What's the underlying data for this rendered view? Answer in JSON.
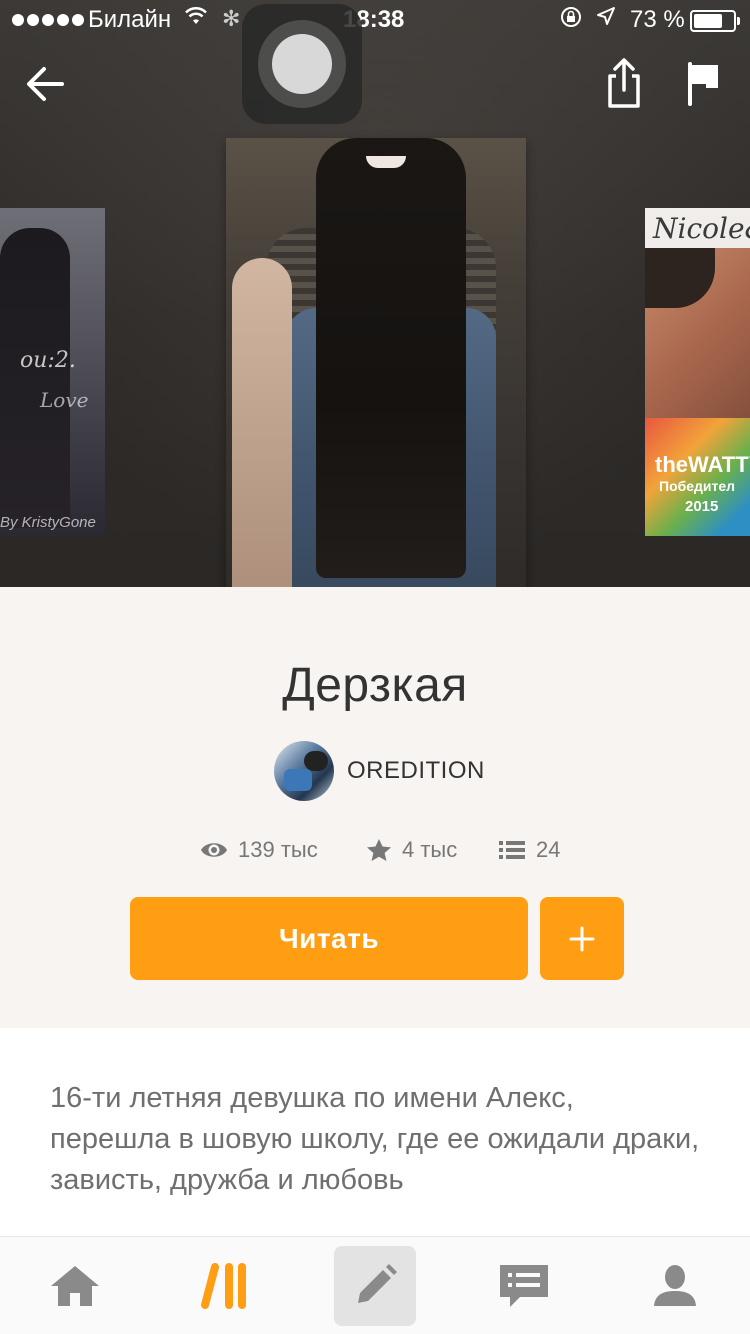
{
  "status_bar": {
    "carrier": "Билайн",
    "time": "18:38",
    "battery_percent": "73 %",
    "battery_level": 0.73
  },
  "toolbar": {
    "back_icon": "arrow-left-icon",
    "share_icon": "share-icon",
    "report_icon": "flag-icon"
  },
  "covers": {
    "left": {
      "title_fragment_1": "ou:2.",
      "title_fragment_2": "Love",
      "author_text": "By KristyGone"
    },
    "right": {
      "title_fragment": "Nicole&",
      "badge_1": "theWATTY",
      "badge_2": "Победител",
      "badge_3": "2015"
    }
  },
  "story": {
    "title": "Дерзкая",
    "author": "OREDITION",
    "stats": {
      "views": "139 тыс",
      "votes": "4 тыс",
      "parts": "24"
    },
    "read_label": "Читать",
    "add_label": "+",
    "description": "16-ти летняя девушка по имени Алекс, перешла в шовую школу, где ее ожидали драки, зависть, дружба и любовь"
  },
  "tab_bar": {
    "items": [
      {
        "name": "home",
        "icon": "home-icon"
      },
      {
        "name": "library",
        "icon": "wattpad-library-icon",
        "active": true
      },
      {
        "name": "write",
        "icon": "pencil-icon"
      },
      {
        "name": "messages",
        "icon": "chat-icon"
      },
      {
        "name": "profile",
        "icon": "person-icon"
      }
    ]
  },
  "colors": {
    "accent": "#ff9e12",
    "hero_bg": "#2e2b29",
    "page_bg": "#f7f4f2"
  }
}
